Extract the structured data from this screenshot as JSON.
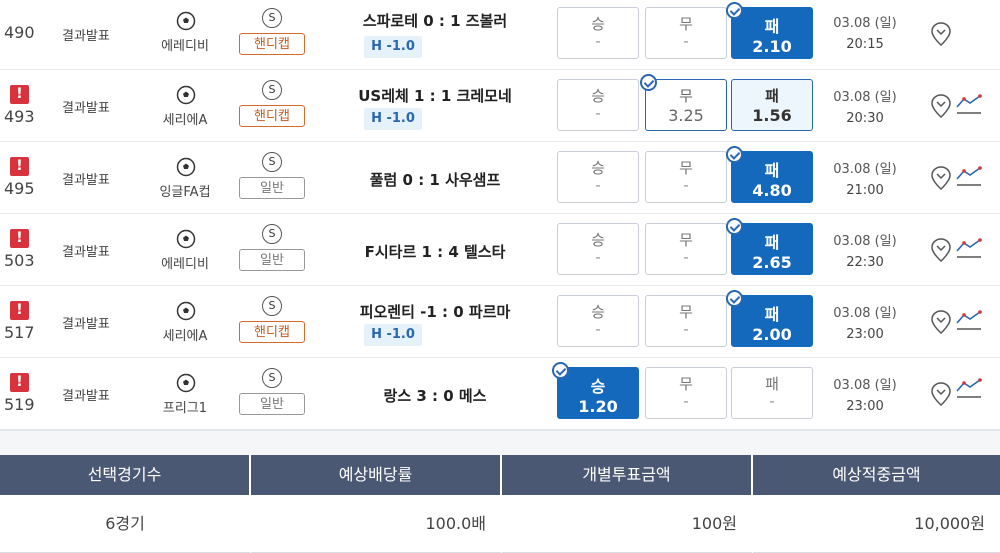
{
  "rows": [
    {
      "num": "490",
      "alert": false,
      "status": "결과발표",
      "league": "에레디비",
      "s": "S",
      "type": "핸디캡",
      "hc": true,
      "match": "스파로테 0 : 1 즈볼러",
      "badge": "H -1.0",
      "win": {
        "label": "승",
        "value": "-"
      },
      "draw": {
        "label": "무",
        "value": "-"
      },
      "lose": {
        "label": "패",
        "value": "2.10"
      },
      "date": "03.08 (일)",
      "time": "20:15",
      "trend": false
    },
    {
      "num": "493",
      "alert": true,
      "status": "결과발표",
      "league": "세리에A",
      "s": "S",
      "type": "핸디캡",
      "hc": true,
      "match": "US레체 1 : 1 크레모네",
      "badge": "H -1.0",
      "win": {
        "label": "승",
        "value": "-"
      },
      "draw": {
        "label": "무",
        "value": "3.25"
      },
      "lose": {
        "label": "패",
        "value": "1.56"
      },
      "date": "03.08 (일)",
      "time": "20:30",
      "trend": true
    },
    {
      "num": "495",
      "alert": true,
      "status": "결과발표",
      "league": "잉글FA컵",
      "s": "S",
      "type": "일반",
      "hc": false,
      "match": "풀럼 0 : 1 사우샘프",
      "badge": "",
      "win": {
        "label": "승",
        "value": "-"
      },
      "draw": {
        "label": "무",
        "value": "-"
      },
      "lose": {
        "label": "패",
        "value": "4.80"
      },
      "date": "03.08 (일)",
      "time": "21:00",
      "trend": true
    },
    {
      "num": "503",
      "alert": true,
      "status": "결과발표",
      "league": "에레디비",
      "s": "S",
      "type": "일반",
      "hc": false,
      "match": "F시타르 1 : 4 텔스타",
      "badge": "",
      "win": {
        "label": "승",
        "value": "-"
      },
      "draw": {
        "label": "무",
        "value": "-"
      },
      "lose": {
        "label": "패",
        "value": "2.65"
      },
      "date": "03.08 (일)",
      "time": "22:30",
      "trend": true
    },
    {
      "num": "517",
      "alert": true,
      "status": "결과발표",
      "league": "세리에A",
      "s": "S",
      "type": "핸디캡",
      "hc": true,
      "match": "피오렌티 -1 : 0 파르마",
      "badge": "H -1.0",
      "win": {
        "label": "승",
        "value": "-"
      },
      "draw": {
        "label": "무",
        "value": "-"
      },
      "lose": {
        "label": "패",
        "value": "2.00"
      },
      "date": "03.08 (일)",
      "time": "23:00",
      "trend": true
    },
    {
      "num": "519",
      "alert": true,
      "status": "결과발표",
      "league": "프리그1",
      "s": "S",
      "type": "일반",
      "hc": false,
      "match": "랑스 3 : 0 메스",
      "badge": "",
      "win": {
        "label": "승",
        "value": "1.20"
      },
      "draw": {
        "label": "무",
        "value": "-"
      },
      "lose": {
        "label": "패",
        "value": "-"
      },
      "date": "03.08 (일)",
      "time": "23:00",
      "trend": true
    }
  ],
  "summary": {
    "headers": [
      "선택경기수",
      "예상배당률",
      "개별투표금액",
      "예상적중금액"
    ],
    "values": [
      "6경기",
      "100.0배",
      "100원",
      "10,000원"
    ]
  },
  "colors": {
    "selected": "#1569bd",
    "alert": "#d8323c",
    "summary_header": "#4b5873"
  }
}
